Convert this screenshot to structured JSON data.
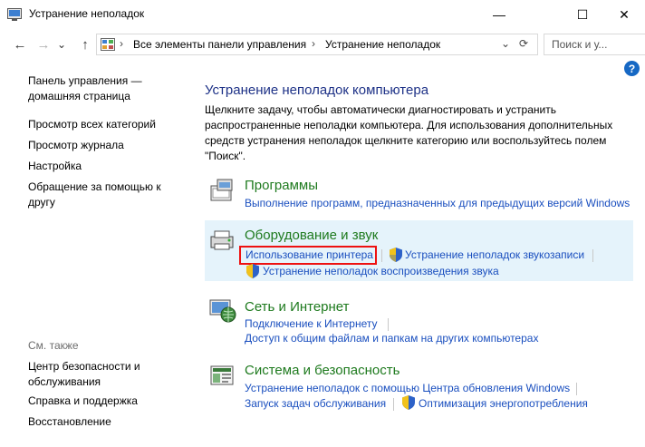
{
  "window": {
    "title": "Устранение неполадок",
    "minimize_symbol": "—",
    "maximize_symbol": "☐",
    "close_symbol": "✕"
  },
  "nav": {
    "back_symbol": "←",
    "forward_symbol": "→",
    "dropdown_symbol": "⌄",
    "up_symbol": "↑",
    "breadcrumb": [
      "Все элементы панели управления",
      "Устранение неполадок"
    ],
    "separator": "›",
    "refresh_symbol": "⟳",
    "search_placeholder": "Поиск и у..."
  },
  "help_symbol": "?",
  "sidebar": {
    "items": [
      {
        "line1": "Панель управления —",
        "line2": "домашняя страница"
      },
      {
        "line1": "Просмотр всех категорий"
      },
      {
        "line1": "Просмотр журнала"
      },
      {
        "line1": "Настройка"
      },
      {
        "line1": "Обращение за помощью к",
        "line2": "другу"
      }
    ],
    "see_also_label": "См. также",
    "see_also": [
      {
        "line1": "Центр безопасности и",
        "line2": "обслуживания"
      },
      {
        "line1": "Справка и поддержка"
      },
      {
        "line1": "Восстановление"
      }
    ]
  },
  "main": {
    "heading": "Устранение неполадок компьютера",
    "description": "Щелкните задачу, чтобы автоматически диагностировать и устранить распространенные неполадки компьютера. Для использования дополнительных средств устранения неполадок щелкните категорию или воспользуйтесь полем \"Поиск\".",
    "categories": [
      {
        "icon": "programs-icon",
        "title": "Программы",
        "links": [
          "Выполнение программ, предназначенных для предыдущих версий Windows"
        ]
      },
      {
        "icon": "hardware-sound-icon",
        "title": "Оборудование и звук",
        "links": [
          "Использование принтера",
          "Устранение неполадок звукозаписи",
          "Устранение неполадок воспроизведения звука"
        ],
        "highlighted": true
      },
      {
        "icon": "network-icon",
        "title": "Сеть и Интернет",
        "links": [
          "Подключение к Интернету",
          "Доступ к общим файлам и папкам на других компьютерах"
        ]
      },
      {
        "icon": "system-security-icon",
        "title": "Система и безопасность",
        "links": [
          "Устранение неполадок с помощью Центра обновления Windows",
          "Запуск задач обслуживания",
          "Оптимизация энергопотребления"
        ]
      }
    ]
  },
  "colors": {
    "heading": "#1e3287",
    "category_title": "#1e7a1e",
    "link": "#1a4fbf",
    "highlight_bg": "#e5f3fb",
    "callout": "#ee1111"
  }
}
